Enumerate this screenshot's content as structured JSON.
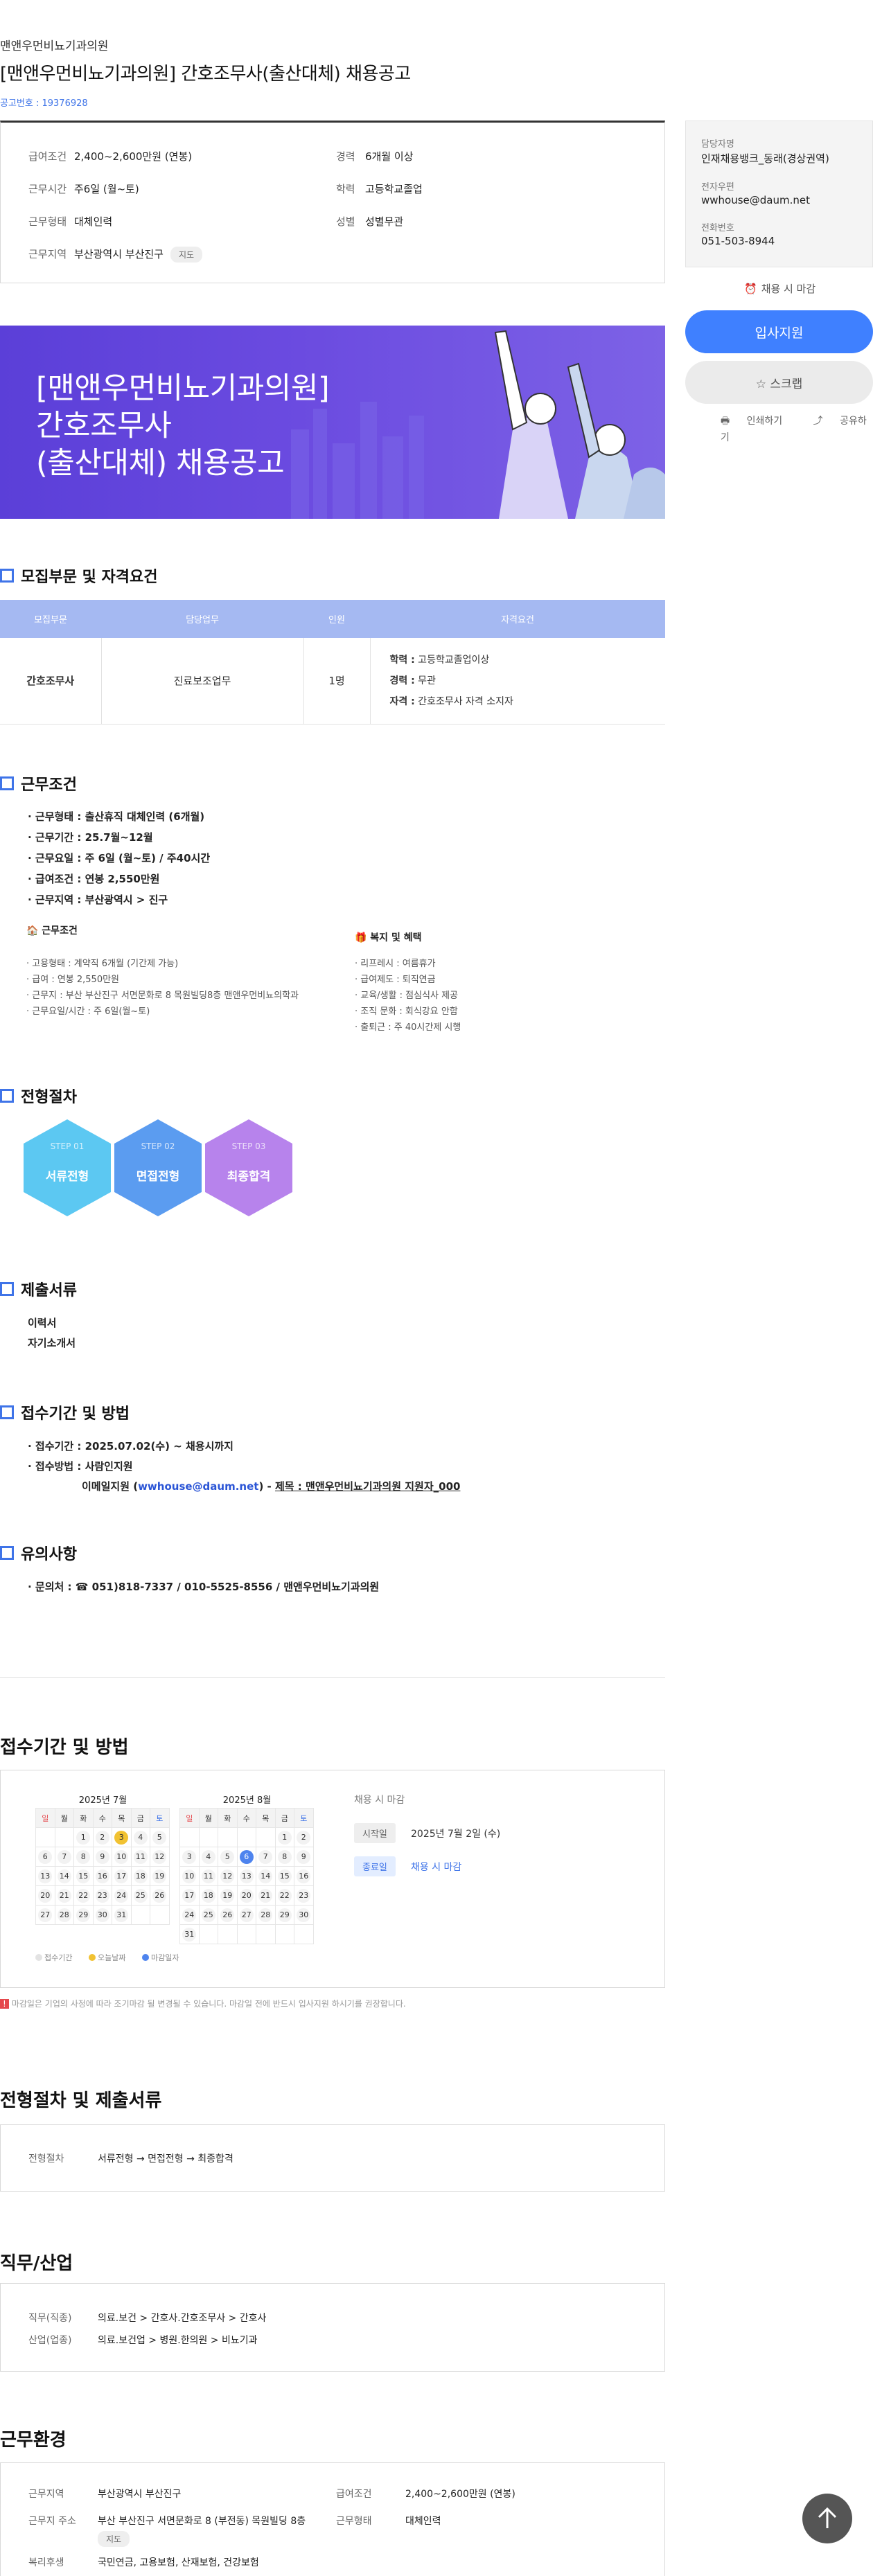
{
  "header": {
    "company": "맨앤우먼비뇨기과의원",
    "title": "[맨앤우먼비뇨기과의원] 간호조무사(출산대체) 채용공고",
    "job_number": "공고번호 : 19376928"
  },
  "summary": {
    "salary_label": "급여조건",
    "salary": "2,400~2,600만원 (연봉)",
    "career_label": "경력",
    "career": "6개월 이상",
    "hours_label": "근무시간",
    "hours": "주6일 (월~토)",
    "edu_label": "학력",
    "edu": "고등학교졸업",
    "type_label": "근무형태",
    "type": "대체인력",
    "gender_label": "성별",
    "gender": "성별무관",
    "area_label": "근무지역",
    "area": "부산광역시 부산진구",
    "map_chip": "지도"
  },
  "contact": {
    "manager_label": "담당자명",
    "manager": "인재채용뱅크_동래(경상권역)",
    "email_label": "전자우편",
    "email": "wwhouse@daum.net",
    "phone_label": "전화번호",
    "phone": "051-503-8944"
  },
  "side": {
    "deadline": "채용 시 마감",
    "apply_button": "입사지원",
    "scrap_button": "☆  스크랩",
    "print": "인쇄하기",
    "share": "공유하기"
  },
  "banner": {
    "line1": "[맨앤우먼비뇨기과의원]",
    "line2": "간호조무사",
    "line3": "(출산대체) 채용공고"
  },
  "recruit": {
    "title": "모집부문 및 자격요건",
    "headers": [
      "모집부문",
      "담당업무",
      "인원",
      "자격요건"
    ],
    "row": {
      "part": "간호조무사",
      "duty": "진료보조업무",
      "count": "1명",
      "req1_k": "학력 :",
      "req1_v": " 고등학교졸업이상",
      "req2_k": "경력 :",
      "req2_v": " 무관",
      "req3_k": "자격 :",
      "req3_v": " 간호조무사 자격 소지자"
    }
  },
  "conditions": {
    "title": "근무조건",
    "items": [
      "· 근무형태 : 출산휴직 대체인력 (6개월)",
      "· 근무기간 : 25.7월~12월",
      "· 근무요일 : 주 6일 (월~토) / 주40시간",
      "· 급여조건 : 연봉 2,550만원",
      "· 근무지역 : 부산광역시 > 진구"
    ],
    "left_title": "🏠 근무조건",
    "left_items": [
      "· 고용형태 : 계약직 6개월 (기간제 가능)",
      "· 급여 : 연봉 2,550만원",
      "· 근무지 : 부산 부산진구 서면문화로 8 목원빌딩8층 맨앤우먼비뇨의학과",
      "· 근무요일/시간 : 주 6일(월~토)"
    ],
    "right_title": "🎁 복지 및 혜택",
    "right_items": [
      "· 리프레시 : 여름휴가",
      "· 급여제도 : 퇴직연금",
      "· 교육/생활 : 점심식사 제공",
      "· 조직 문화 : 회식강요 안함",
      "· 출퇴근 : 주 40시간제 시행"
    ]
  },
  "process": {
    "title": "전형절차",
    "steps": [
      {
        "num": "STEP 01",
        "name": "서류전형",
        "color": "#5cc8f2"
      },
      {
        "num": "STEP 02",
        "name": "면접전형",
        "color": "#5b9cf0"
      },
      {
        "num": "STEP 03",
        "name": "최종합격",
        "color": "#b783ec"
      }
    ]
  },
  "documents": {
    "title": "제출서류",
    "items": [
      "이력서",
      "자기소개서"
    ]
  },
  "apply": {
    "title": "접수기간 및 방법",
    "period": "· 접수기간 : 2025.07.02(수) ~ 채용시까지",
    "method": "· 접수방법 : 사람인지원",
    "email_pre": "이메일지원 (",
    "email": "wwhouse@daum.net",
    "email_post": ") - ",
    "subject": "제목 : 맨앤우먼비뇨기과의원 지원자_000"
  },
  "caution": {
    "title": "유의사항",
    "contact": "· 문의처 : ☎ 051)818-7337 / 010-5525-8556 / 맨앤우먼비뇨기과의원"
  },
  "period_section": {
    "title": "접수기간 및 방법",
    "july_title": "2025년 7월",
    "aug_title": "2025년 8월",
    "weekdays": [
      "일",
      "월",
      "화",
      "수",
      "목",
      "금",
      "토"
    ],
    "july_days": [
      "",
      "",
      "1",
      "2",
      "3",
      "4",
      "5",
      "6",
      "7",
      "8",
      "9",
      "10",
      "11",
      "12",
      "13",
      "14",
      "15",
      "16",
      "17",
      "18",
      "19",
      "20",
      "21",
      "22",
      "23",
      "24",
      "25",
      "26",
      "27",
      "28",
      "29",
      "30",
      "31",
      "",
      ""
    ],
    "aug_days": [
      "",
      "",
      "",
      "",
      "",
      "1",
      "2",
      "3",
      "4",
      "5",
      "6",
      "7",
      "8",
      "9",
      "10",
      "11",
      "12",
      "13",
      "14",
      "15",
      "16",
      "17",
      "18",
      "19",
      "20",
      "21",
      "22",
      "23",
      "24",
      "25",
      "26",
      "27",
      "28",
      "29",
      "30",
      "31",
      "",
      "",
      "",
      "",
      "",
      ""
    ],
    "legend": [
      "접수기간",
      "오늘날짜",
      "마감일자"
    ],
    "side_deadline": "채용 시 마감",
    "start_tag": "시작일",
    "start_val": "2025년 7월 2일 (수)",
    "end_tag": "종료일",
    "end_val": "채용 시 마감",
    "notice": "마감일은 기업의 사정에 따라 조기마감 될 변경될 수 있습니다. 마감일 전에 반드시 입사지원 하시기를 권장합니다."
  },
  "process_docs": {
    "title": "전형절차 및 제출서류",
    "label": "전형절차",
    "value": "서류전형 → 면접전형 → 최종합격"
  },
  "industry": {
    "title": "직무/산업",
    "job_label": "직무(직종)",
    "job": "의료.보건 > 간호사.간호조무사 > 간호사",
    "ind_label": "산업(업종)",
    "ind": "의료.보건업 > 병원.한의원 > 비뇨기과"
  },
  "environment": {
    "title": "근무환경",
    "area_label": "근무지역",
    "area": "부산광역시 부산진구",
    "salary_label": "급여조건",
    "salary": "2,400~2,600만원 (연봉)",
    "addr_label": "근무지 주소",
    "addr": "부산 부산진구 서면문화로 8 (부전동) 목원빌딩 8층",
    "type_label": "근무형태",
    "type": "대체인력",
    "map_chip": "지도",
    "welfare_label": "복리후생",
    "welfare": "국민연금, 고용보험, 산재보험, 건강보험"
  }
}
